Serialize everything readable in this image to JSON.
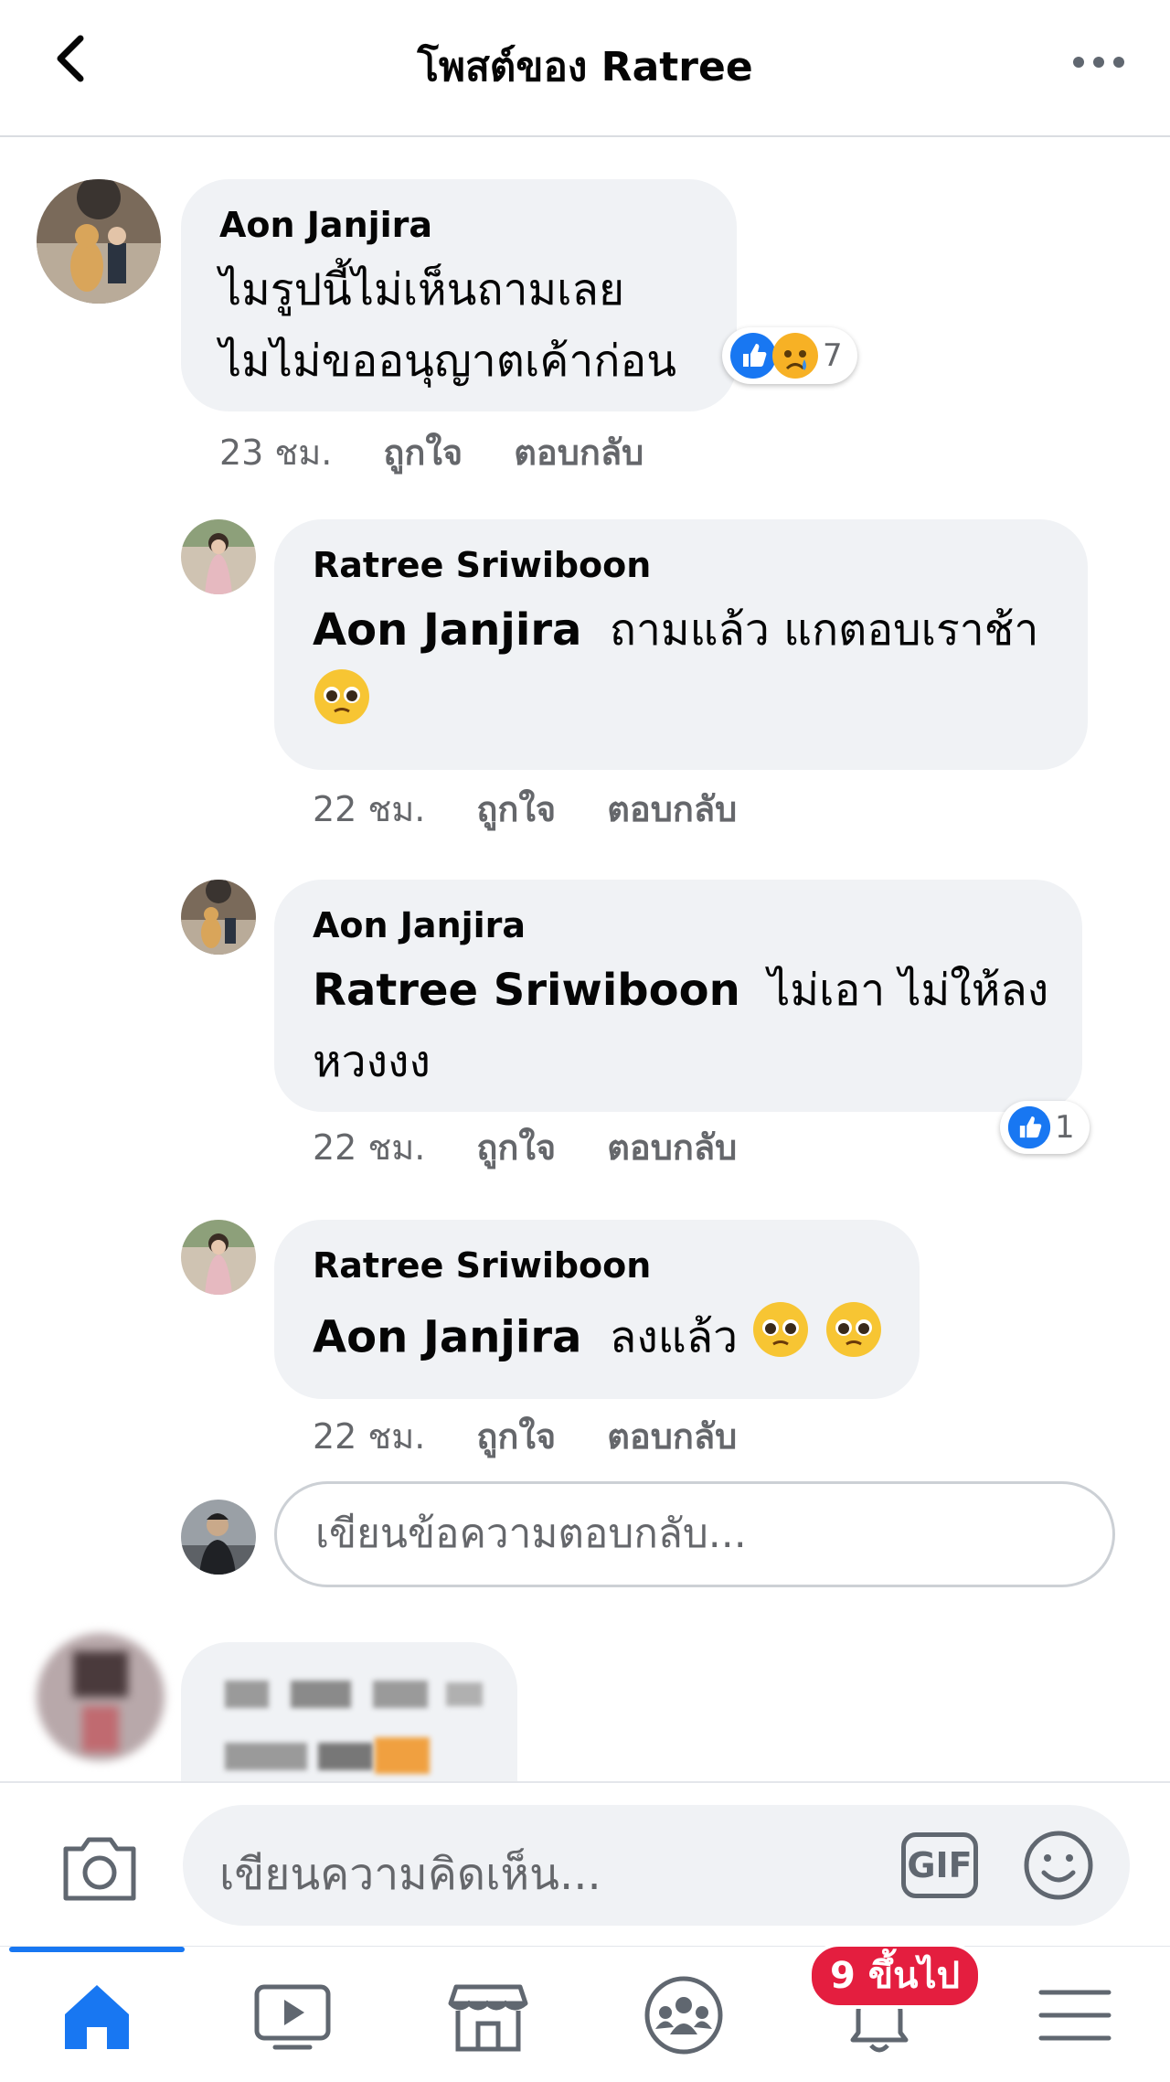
{
  "header": {
    "title": "โพสต์ของ Ratree",
    "back_icon": "chevron-left-icon",
    "more_icon": "more-horizontal-icon"
  },
  "comments": [
    {
      "author": "Aon Janjira",
      "text_line1": "ไมรูปนี้ไม่เห็นถามเลย",
      "text_line2": "ไมไม่ขออนุญาตเค้าก่อน",
      "time": "23 ชม.",
      "like_label": "ถูกใจ",
      "reply_label": "ตอบกลับ",
      "reactions": [
        "like",
        "sad"
      ],
      "reaction_count": "7"
    }
  ],
  "replies": [
    {
      "author": "Ratree Sriwiboon",
      "mention": "Aon Janjira",
      "text": "ถามแล้ว แกตอบเราช้า",
      "emoji": "🥺",
      "time": "22 ชม.",
      "like_label": "ถูกใจ",
      "reply_label": "ตอบกลับ"
    },
    {
      "author": "Aon Janjira",
      "mention": "Ratree Sriwiboon",
      "text": "ไม่เอา ไม่ให้ลง",
      "text_line2": "หวงงง",
      "time": "22 ชม.",
      "like_label": "ถูกใจ",
      "reply_label": "ตอบกลับ",
      "reactions": [
        "like"
      ],
      "reaction_count": "1"
    },
    {
      "author": "Ratree Sriwiboon",
      "mention": "Aon Janjira",
      "text": "ลงแล้ว",
      "emoji": "🥺🥺",
      "time": "22 ชม.",
      "like_label": "ถูกใจ",
      "reply_label": "ตอบกลับ"
    }
  ],
  "reply_box": {
    "placeholder": "เขียนข้อความตอบกลับ..."
  },
  "composer": {
    "placeholder": "เขียนความคิดเห็น...",
    "gif_label": "GIF",
    "camera_icon": "camera-icon",
    "emoji_icon": "smiley-icon"
  },
  "tabbar": {
    "items": [
      "home-icon",
      "video-icon",
      "marketplace-icon",
      "groups-icon",
      "notifications-icon",
      "menu-icon"
    ],
    "notification_badge": "9 ขึ้นไป",
    "active_index": 0
  },
  "colors": {
    "accent": "#1877f2",
    "bubble": "#f0f2f5",
    "badge": "#e41e3f",
    "meta_text": "#65676b"
  }
}
